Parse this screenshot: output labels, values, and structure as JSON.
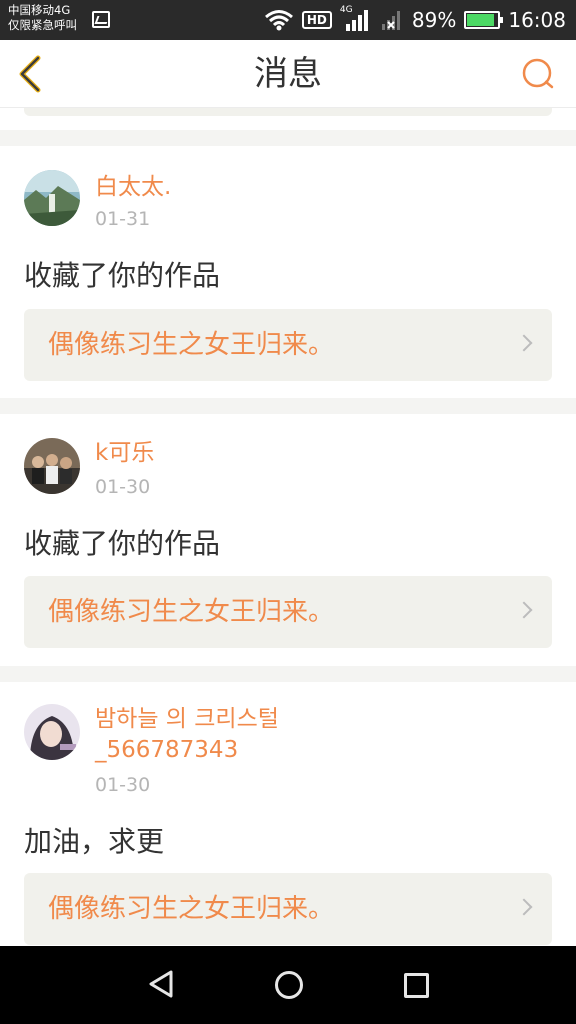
{
  "status_bar": {
    "carrier_line1": "中国移动4G",
    "carrier_line2": "仅限紧急呼叫",
    "hd": "HD",
    "network": "4G",
    "battery": "89%",
    "time": "16:08"
  },
  "header": {
    "title": "消息",
    "back_icon": "chevron-left-icon",
    "search_icon": "search-icon",
    "accent_color": "#f08a4b"
  },
  "messages": [
    {
      "user": "白太太.",
      "date": "01-31",
      "text": "收藏了你的作品",
      "work_title": "偶像练习生之女王归来。"
    },
    {
      "user": "k可乐",
      "date": "01-30",
      "text": "收藏了你的作品",
      "work_title": "偶像练习生之女王归来。"
    },
    {
      "user": "밤하늘 의 크리스털",
      "user_line2": "_566787343",
      "date": "01-30",
      "text": "加油，求更",
      "work_title": "偶像练习生之女王归来。"
    }
  ],
  "nav": {
    "back_icon": "triangle-back-icon",
    "home_icon": "circle-home-icon",
    "recent_icon": "square-recents-icon"
  }
}
